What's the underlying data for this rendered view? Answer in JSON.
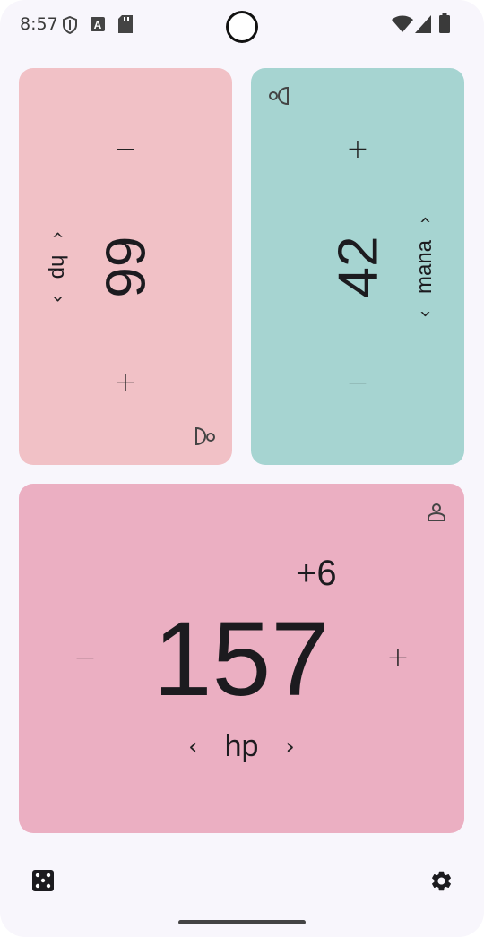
{
  "status_bar": {
    "time": "8:57",
    "icons_left": [
      "shield-icon",
      "a-badge-icon",
      "sd-card-icon"
    ],
    "icons_right": [
      "wifi-icon",
      "signal-icon",
      "battery-icon"
    ]
  },
  "counters": [
    {
      "id": "p1",
      "label": "hp",
      "value": "66",
      "plus": "+",
      "minus": "−",
      "color": "#f1c1c6",
      "icon": "two-player-icon"
    },
    {
      "id": "p2",
      "label": "mana",
      "value": "42",
      "plus": "+",
      "minus": "−",
      "color": "#a6d4d1",
      "icon": "two-player-icon"
    },
    {
      "id": "p3",
      "label": "hp",
      "value": "157",
      "delta": "+6",
      "plus": "+",
      "minus": "−",
      "color": "#ebafc2",
      "icon": "person-icon"
    }
  ],
  "chevrons": {
    "prev": "‹",
    "next": "›"
  },
  "toolbar": {
    "dice_icon": "dice-icon",
    "settings_icon": "gear-icon"
  }
}
